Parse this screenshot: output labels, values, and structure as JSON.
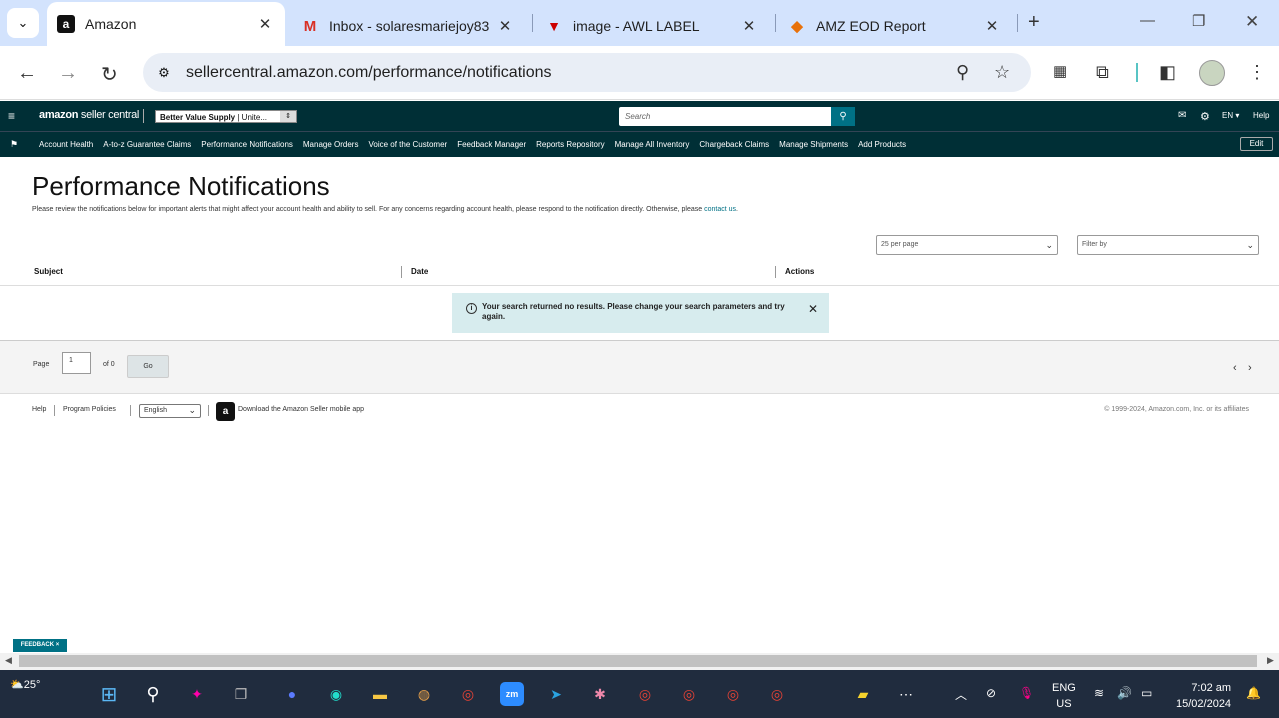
{
  "browser": {
    "tabs": [
      {
        "title": "Amazon",
        "active": true,
        "favicon": "amazon-icon"
      },
      {
        "title": "Inbox - solaresmariejoy83",
        "active": false,
        "favicon": "gmail-icon"
      },
      {
        "title": "image - AWL LABEL",
        "active": false,
        "favicon": "awl-icon"
      },
      {
        "title": "AMZ EOD Report",
        "active": false,
        "favicon": "report-icon"
      }
    ],
    "url": "sellercentral.amazon.com/performance/notifications"
  },
  "seller_header": {
    "logo_bold": "amazon",
    "logo_rest": " seller central",
    "store_name": "Better Value Supply",
    "store_region": " | Unite...",
    "search_placeholder": "Search",
    "lang": "EN",
    "help": "Help"
  },
  "nav": {
    "items": [
      "Account Health",
      "A-to-z Guarantee Claims",
      "Performance Notifications",
      "Manage Orders",
      "Voice of the Customer",
      "Feedback Manager",
      "Reports Repository",
      "Manage All Inventory",
      "Chargeback Claims",
      "Manage Shipments",
      "Add Products"
    ],
    "edit": "Edit"
  },
  "page": {
    "title": "Performance Notifications",
    "description": "Please review the notifications below for important alerts that might affect your account health and ability to sell. For any concerns regarding account health, please respond to the notification directly. Otherwise, please ",
    "contact_link": "contact us",
    "description_end": ".",
    "per_page": "25 per page",
    "filter_by": "Filter by"
  },
  "table": {
    "columns": [
      "Subject",
      "Date",
      "Actions"
    ],
    "alert": "Your search returned no results. Please change your search parameters and try again."
  },
  "pagination": {
    "page_label": "Page",
    "page_value": "1",
    "of_label": "of 0",
    "go": "Go"
  },
  "footer": {
    "help": "Help",
    "program_policies": "Program Policies",
    "language": "English",
    "download_app": "Download the Amazon Seller mobile app",
    "copyright": "© 1999-2024, Amazon.com, Inc. or its affiliates"
  },
  "feedback": "FEEDBACK ×",
  "taskbar": {
    "temperature": "25°",
    "lang_top": "ENG",
    "lang_bottom": "US",
    "time": "7:02 am",
    "date": "15/02/2024"
  }
}
